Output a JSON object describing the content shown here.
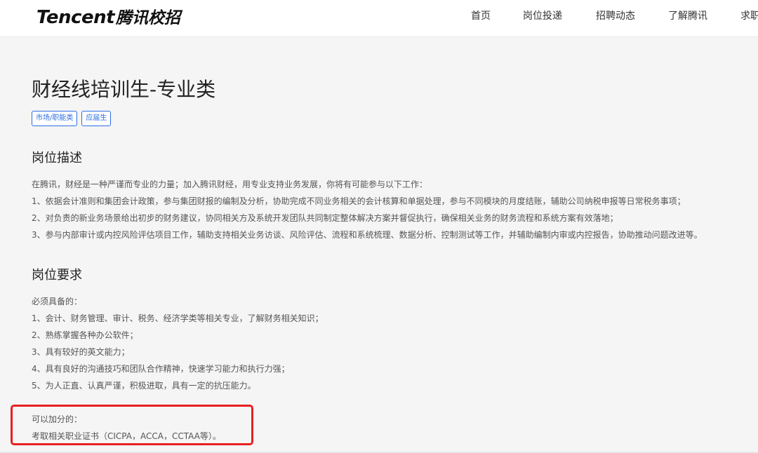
{
  "header": {
    "logo_en": "Tencent",
    "logo_cn": "腾讯校招",
    "nav": [
      "首页",
      "岗位投递",
      "招聘动态",
      "了解腾讯",
      "求职"
    ]
  },
  "job": {
    "title": "财经线培训生-专业类",
    "tags": [
      "市场/职能类",
      "应届生"
    ]
  },
  "description": {
    "heading": "岗位描述",
    "lines": [
      "在腾讯，财经是一种严谨而专业的力量；加入腾讯财经，用专业支持业务发展，你将有可能参与以下工作：",
      "1、依据会计准则和集团会计政策，参与集团财报的编制及分析，协助完成不同业务相关的会计核算和单据处理，参与不同模块的月度结账，辅助公司纳税申报等日常税务事项；",
      "2、对负责的新业务场景给出初步的财务建议，协同相关方及系统开发团队共同制定整体解决方案并督促执行，确保相关业务的财务流程和系统方案有效落地；",
      "3、参与内部审计或内控风险评估项目工作，辅助支持相关业务访谈、风险评估、流程和系统梳理、数据分析、控制测试等工作，并辅助编制内审或内控报告，协助推动问题改进等。"
    ]
  },
  "requirements": {
    "heading": "岗位要求",
    "required_label": "必须具备的：",
    "required": [
      "1、会计、财务管理、审计、税务、经济学类等相关专业，了解财务相关知识；",
      "2、熟练掌握各种办公软件；",
      "3、具有较好的英文能力；",
      "4、具有良好的沟通技巧和团队合作精神，快速学习能力和执行力强；",
      "5、为人正直、认真严谨，积极进取，具有一定的抗压能力。"
    ],
    "bonus_label": "可以加分的：",
    "bonus": [
      "考取相关职业证书（CICPA，ACCA，CCTAA等）。"
    ]
  },
  "colors": {
    "accent": "#2b6de5",
    "highlight": "#e8201f",
    "background": "#f5f5f5"
  }
}
